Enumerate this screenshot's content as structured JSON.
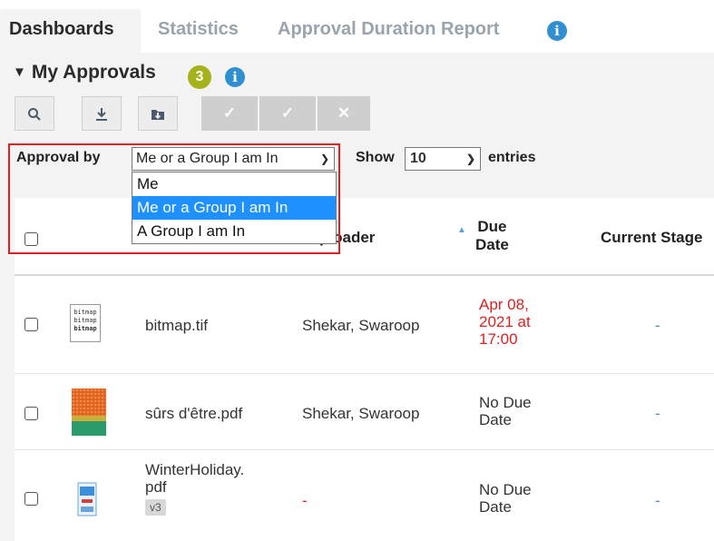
{
  "tabs": [
    {
      "label": "Dashboards",
      "active": true
    },
    {
      "label": "Statistics",
      "active": false
    },
    {
      "label": "Approval Duration Report",
      "active": false
    }
  ],
  "info_icon_glyph": "i",
  "section": {
    "title": "My Approvals",
    "count": "3"
  },
  "toolbar": {
    "buttons": [
      {
        "icon": "search-icon"
      },
      {
        "icon": "download-icon"
      },
      {
        "icon": "folder-download-icon"
      },
      {
        "icon": "check-icon"
      },
      {
        "icon": "check-split-icon"
      },
      {
        "icon": "x-icon"
      }
    ]
  },
  "filter": {
    "approval_label": "Approval by",
    "selected": "Me or a Group I am In",
    "options": [
      "Me",
      "Me or a Group I am In",
      "A Group I am In"
    ],
    "show_label": "Show",
    "entries_value": "10",
    "entries_label": "entries"
  },
  "table": {
    "headers": {
      "uploader": "Uploader",
      "due": "Due Date",
      "stage": "Current Stage"
    },
    "visible_header_fragments": {
      "uploader": "ploader",
      "due_line1": "Due",
      "due_line2": "Date"
    },
    "rows": [
      {
        "thumb_text": [
          "bitmap",
          "bitmap",
          "bitmap"
        ],
        "name": "bitmap.tif",
        "uploader": "Shekar, Swaroop",
        "due": [
          "Apr 08,",
          "2021 at",
          "17:00"
        ],
        "due_overdue": true,
        "stage": "-"
      },
      {
        "name": "sûrs d'être.pdf",
        "uploader": "Shekar, Swaroop",
        "due": [
          "No Due",
          "Date"
        ],
        "due_overdue": false,
        "stage": "-"
      },
      {
        "name": [
          "WinterHoliday.",
          "pdf"
        ],
        "version": "v3",
        "uploader": "-",
        "due": [
          "No Due",
          "Date"
        ],
        "due_overdue": false,
        "stage": "-"
      }
    ]
  },
  "colors": {
    "accent": "#2f8fd0",
    "count_badge": "#a5b21a",
    "selected_option": "#1e90ff",
    "highlight_frame": "#e02020",
    "overdue": "#e02020"
  }
}
